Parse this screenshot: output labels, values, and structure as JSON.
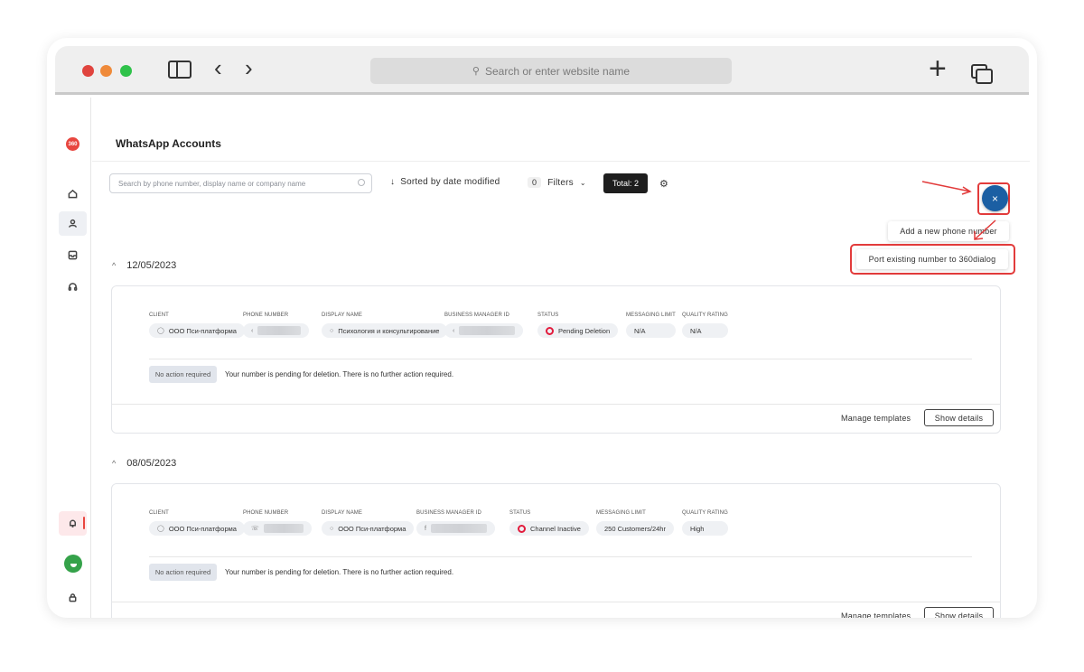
{
  "browser": {
    "url_placeholder": "Search or enter website name",
    "back_glyph": "‹",
    "forward_glyph": "›",
    "new_tab_glyph": "+"
  },
  "appnav": {
    "logo_text": "360",
    "items": [
      "home-icon",
      "user-icon",
      "inbox-icon",
      "headset-icon",
      "bell-icon",
      "lock-icon"
    ]
  },
  "page": {
    "title": "WhatsApp Accounts",
    "search_placeholder": "Search by phone number, display name or company name",
    "sort_label": "Sorted by date modified",
    "filters_count": "0",
    "filters_label": "Filters",
    "total_label": "Total: 2",
    "fab_glyph": "×",
    "menu": {
      "add_label": "Add a new phone number",
      "port_label": "Port existing number to 360dialog"
    },
    "highlight_color": "#e23b3b",
    "accent_color": "#1b5fa3"
  },
  "labels": {
    "client": "CLIENT",
    "phone": "PHONE NUMBER",
    "display": "DISPLAY NAME",
    "bm": "BUSINESS MANAGER ID",
    "status": "STATUS",
    "limit": "MESSAGING LIMIT",
    "quality": "QUALITY RATING",
    "no_action": "No action required",
    "manage": "Manage templates",
    "details": "Show details"
  },
  "groups": [
    {
      "date": "12/05/2023",
      "client": "ООО Пси-платформа",
      "display_name": "Психология и консультирование",
      "status": "Pending Deletion",
      "messaging_limit": "N/A",
      "quality_rating": "N/A",
      "note": "Your number is pending for deletion. There is no further action required."
    },
    {
      "date": "08/05/2023",
      "client": "ООО Пси-платформа",
      "display_name": "ООО Пси-платформа",
      "status": "Channel Inactive",
      "messaging_limit": "250 Customers/24hr",
      "quality_rating": "High",
      "note": "Your number is pending for deletion. There is no further action required."
    }
  ]
}
